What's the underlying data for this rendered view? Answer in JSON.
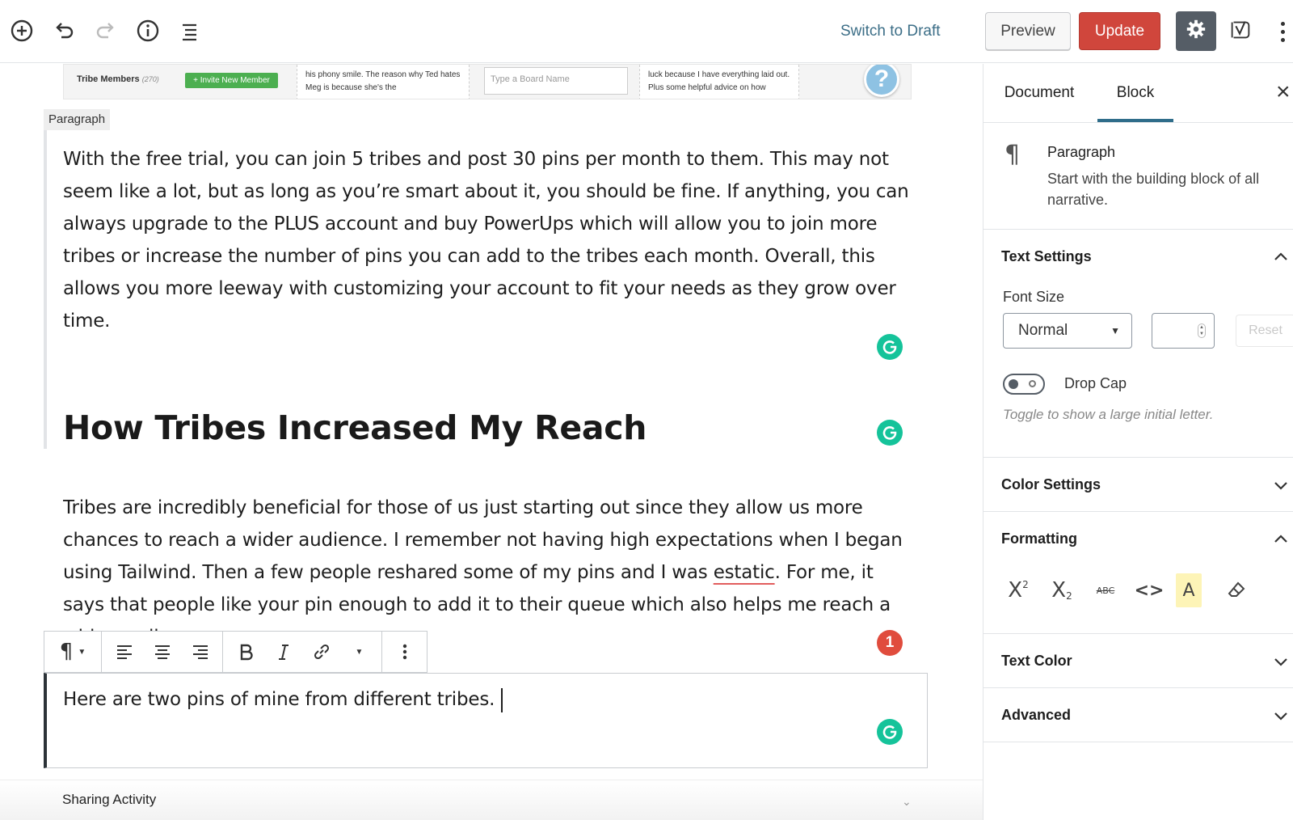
{
  "topbar": {
    "switch_draft_label": "Switch to Draft",
    "preview_label": "Preview",
    "update_label": "Update",
    "update_color": "#d0463c",
    "icons": [
      "add-block-icon",
      "undo-icon",
      "redo-icon",
      "info-icon",
      "outline-icon",
      "gear-icon",
      "yoast-icon",
      "more-vertical-icon"
    ]
  },
  "editor": {
    "screenshot_strip": {
      "tribe_members": "Tribe Members",
      "tribe_count": "(270)",
      "invite_label": "Invite New Member",
      "col1_text": "his phony smile. The reason why Ted hates Meg is because she's the",
      "board_placeholder": "Type a Board Name",
      "col2_text": "luck because I have everything laid out. Plus some helpful advice on how",
      "help_label": "?"
    },
    "block_label": "Paragraph",
    "paragraph1": "With the free trial, you can join 5 tribes and post 30 pins per month to them. This may not seem like a lot, but as long as you’re smart about it, you should be fine. If anything, you can always upgrade to the PLUS account and buy PowerUps which will allow you to join more tribes or increase the number of pins you can add to the tribes each month. Overall, this allows you more leeway with customizing your account to fit your needs as they grow over time.",
    "heading": "How Tribes Increased My Reach",
    "paragraph2_before": "Tribes are incredibly beneficial for those of us just starting out since they allow us more chances to reach a wider audience. I remember not having high expectations when I began using Tailwind. Then a few people reshared some of my pins and I was ",
    "paragraph2_misspelled": "estatic",
    "paragraph2_after": ". For me, it says that people like your pin enough to add it to their queue which also helps me reach a wider audience.",
    "grammarly_error_count": "1",
    "paragraph3": "Here are two pins of mine from different tribes.",
    "sharing_activity": "Sharing Activity"
  },
  "sidebar": {
    "tabs": [
      {
        "label": "Document",
        "active": false
      },
      {
        "label": "Block",
        "active": true
      }
    ],
    "close_label": "×",
    "block_info": {
      "icon": "¶",
      "title": "Paragraph",
      "description": "Start with the building block of all narrative."
    },
    "text_settings": {
      "title": "Text Settings",
      "font_size_label": "Font Size",
      "font_size_value": "Normal",
      "reset_label": "Reset",
      "drop_cap_label": "Drop Cap",
      "drop_cap_help": "Toggle to show a large initial letter."
    },
    "color_settings_title": "Color Settings",
    "formatting": {
      "title": "Formatting",
      "buttons": [
        "superscript-icon",
        "subscript-icon",
        "strikethrough-icon",
        "code-icon",
        "highlight-icon",
        "clear-format-icon"
      ]
    },
    "text_color_title": "Text Color",
    "advanced_title": "Advanced"
  }
}
